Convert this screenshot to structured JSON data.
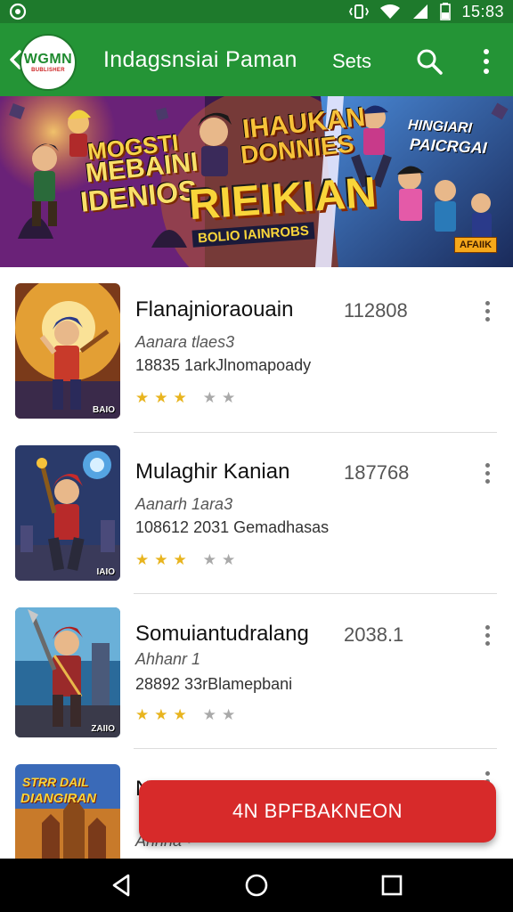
{
  "status_bar": {
    "time": "15:83",
    "icons": [
      "notification-icon",
      "vibrate-icon",
      "wifi-icon",
      "signal-icon",
      "battery-icon"
    ]
  },
  "app_bar": {
    "logo_text": "WGMN",
    "logo_subtext": "BUBLISHER",
    "title": "Indagsnsiai Paman",
    "action_label": "Sets",
    "icons": [
      "back-chevron-icon",
      "search-icon",
      "more-vert-icon"
    ],
    "color": "#249436"
  },
  "banner": {
    "left_title_1": "MOGSTI",
    "left_title_2": "MEBAINI",
    "left_title_3": "IDENIOS",
    "center_title_1": "IHAUKAN",
    "center_title_2": "DONNIES",
    "main_title": "RIEIKIAN",
    "main_subtitle": "BOLIO IAINROBS",
    "right_title_1": "HINGIARI",
    "right_title_2": "PAICRGAI",
    "badge": "AFAIIK"
  },
  "items": [
    {
      "title": "Flanajnioraouain",
      "number": "112808",
      "subtitle": "Aanara tlaes3",
      "description": "18835 1arkJlnomapoady",
      "rating": 3,
      "thumb_tag": "BAIO"
    },
    {
      "title": "Mulaghir Kanian",
      "number": "187768",
      "subtitle": "Aanarh 1ara3",
      "description": "108612 2031 Gemadhasas",
      "rating": 3,
      "thumb_tag": "IAIO"
    },
    {
      "title": "Somuiantudralang",
      "number": "2038.1",
      "subtitle": "Ahhanr 1",
      "description": "28892 33rBlamepbani",
      "rating": 3,
      "thumb_tag": "ZAIIO"
    },
    {
      "title": "N",
      "number": "",
      "subtitle": "Ahnna •",
      "description": "",
      "rating": 0,
      "thumb_tag": "",
      "thumb_title_1": "STRR DAIL",
      "thumb_title_2": "DIANGIRAN"
    }
  ],
  "action_button": {
    "label": "4N BPFBAKNEON",
    "color": "#d72a2a"
  },
  "nav_bar": {
    "icons": [
      "back-triangle-icon",
      "home-circle-icon",
      "recents-square-icon"
    ]
  }
}
